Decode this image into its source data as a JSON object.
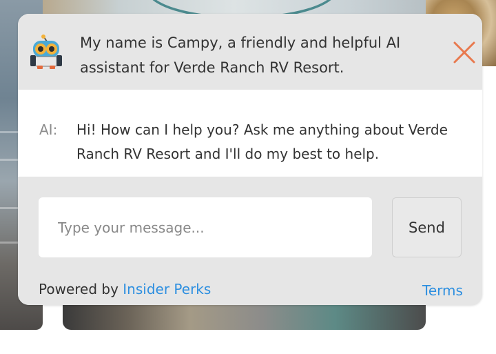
{
  "header": {
    "intro_line1": "My name is Campy, a friendly and helpful AI",
    "intro_line2": "assistant for Verde Ranch RV Resort.",
    "avatar_icon": "robot-mascot-icon",
    "close_icon": "close-x-icon"
  },
  "messages": [
    {
      "sender": "AI:",
      "text": "Hi! How can I help you? Ask me anything about Verde Ranch RV Resort and I'll do my best to help."
    }
  ],
  "composer": {
    "placeholder": "Type your message...",
    "value": "",
    "send_label": "Send"
  },
  "footer": {
    "powered_prefix": "Powered by ",
    "powered_link": "Insider Perks",
    "terms_link": "Terms"
  },
  "colors": {
    "panel_bg": "#e6e6e6",
    "link": "#2d8fe0",
    "close_icon": "#e8794e",
    "text": "#333333"
  }
}
